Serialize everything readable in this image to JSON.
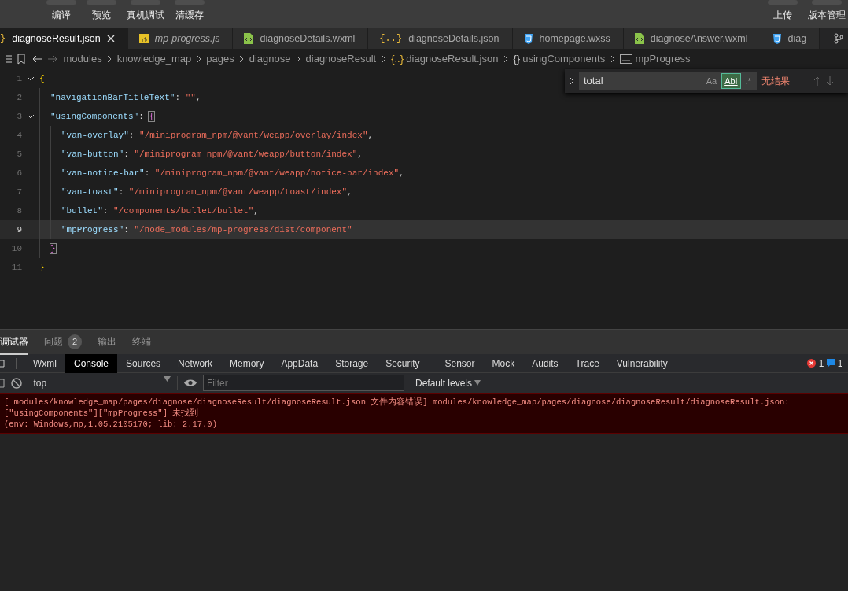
{
  "toolbar": {
    "left_buttons": [
      "编译",
      "预览",
      "真机调试",
      "清缓存"
    ],
    "right_buttons": [
      "上传",
      "版本管理"
    ]
  },
  "tabs": [
    {
      "label": "diagnoseResult.json",
      "kind": "json",
      "icon": "}",
      "selected": true,
      "preview": false,
      "closable": true
    },
    {
      "label": "mp-progress.js",
      "kind": "js",
      "selected": false,
      "preview": true,
      "closable": false
    },
    {
      "label": "diagnoseDetails.wxml",
      "kind": "wxml",
      "selected": false,
      "preview": false,
      "closable": false
    },
    {
      "label": "diagnoseDetails.json",
      "kind": "json",
      "icon": "{..}",
      "selected": false,
      "preview": false,
      "closable": false
    },
    {
      "label": "homepage.wxss",
      "kind": "wxss",
      "selected": false,
      "preview": false,
      "closable": false
    },
    {
      "label": "diagnoseAnswer.wxml",
      "kind": "wxml",
      "selected": false,
      "preview": false,
      "closable": false
    },
    {
      "label": "diag",
      "kind": "wxss",
      "selected": false,
      "preview": false,
      "closable": false
    }
  ],
  "breadcrumb": [
    {
      "label": "modules",
      "kind": "folder"
    },
    {
      "label": "knowledge_map",
      "kind": "folder"
    },
    {
      "label": "pages",
      "kind": "folder"
    },
    {
      "label": "diagnose",
      "kind": "folder"
    },
    {
      "label": "diagnoseResult",
      "kind": "folder"
    },
    {
      "label": "diagnoseResult.json",
      "kind": "json",
      "icon": "{..}"
    },
    {
      "label": "usingComponents",
      "kind": "object",
      "icon": "{}"
    },
    {
      "label": "mpProgress",
      "kind": "string"
    }
  ],
  "editor": {
    "lines": [
      {
        "number": "1",
        "foldable": true,
        "current": false,
        "tokens": [
          {
            "kind": "brace",
            "text": "{"
          }
        ],
        "children": [
          {
            "number": "2",
            "foldable": false,
            "current": false,
            "tokens": [
              {
                "kind": "key",
                "text": "\"navigationBarTitleText\""
              },
              {
                "kind": "punct",
                "text": ": "
              },
              {
                "kind": "string",
                "text": "\"\""
              },
              {
                "kind": "punct",
                "text": ","
              }
            ]
          },
          {
            "number": "3",
            "foldable": true,
            "current": false,
            "tokens": [
              {
                "kind": "key",
                "text": "\"usingComponents\""
              },
              {
                "kind": "punct",
                "text": ": "
              },
              {
                "kind": "matched",
                "text": "{"
              }
            ],
            "children": [
              {
                "number": "4",
                "foldable": false,
                "current": false,
                "tokens": [
                  {
                    "kind": "key",
                    "text": "\"van-overlay\""
                  },
                  {
                    "kind": "punct",
                    "text": ": "
                  },
                  {
                    "kind": "string",
                    "text": "\"/miniprogram_npm/@vant/weapp/overlay/index\""
                  },
                  {
                    "kind": "punct",
                    "text": ","
                  }
                ]
              },
              {
                "number": "5",
                "foldable": false,
                "current": false,
                "tokens": [
                  {
                    "kind": "key",
                    "text": "\"van-button\""
                  },
                  {
                    "kind": "punct",
                    "text": ": "
                  },
                  {
                    "kind": "string",
                    "text": "\"/miniprogram_npm/@vant/weapp/button/index\""
                  },
                  {
                    "kind": "punct",
                    "text": ","
                  }
                ]
              },
              {
                "number": "6",
                "foldable": false,
                "current": false,
                "tokens": [
                  {
                    "kind": "key",
                    "text": "\"van-notice-bar\""
                  },
                  {
                    "kind": "punct",
                    "text": ": "
                  },
                  {
                    "kind": "string",
                    "text": "\"/miniprogram_npm/@vant/weapp/notice-bar/index\""
                  },
                  {
                    "kind": "punct",
                    "text": ","
                  }
                ]
              },
              {
                "number": "7",
                "foldable": false,
                "current": false,
                "tokens": [
                  {
                    "kind": "key",
                    "text": "\"van-toast\""
                  },
                  {
                    "kind": "punct",
                    "text": ": "
                  },
                  {
                    "kind": "string",
                    "text": "\"/miniprogram_npm/@vant/weapp/toast/index\""
                  },
                  {
                    "kind": "punct",
                    "text": ","
                  }
                ]
              },
              {
                "number": "8",
                "foldable": false,
                "current": false,
                "tokens": [
                  {
                    "kind": "key",
                    "text": "\"bullet\""
                  },
                  {
                    "kind": "punct",
                    "text": ": "
                  },
                  {
                    "kind": "string",
                    "text": "\"/components/bullet/bullet\""
                  },
                  {
                    "kind": "punct",
                    "text": ","
                  }
                ]
              },
              {
                "number": "9",
                "foldable": false,
                "current": true,
                "tokens": [
                  {
                    "kind": "key",
                    "text": "\"mpProgress\""
                  },
                  {
                    "kind": "punct",
                    "text": ": "
                  },
                  {
                    "kind": "string",
                    "text": "\"/node_modules/mp-progress/dist/component\""
                  }
                ]
              }
            ]
          },
          {
            "number": "10",
            "foldable": false,
            "current": false,
            "tokens": [
              {
                "kind": "matched",
                "text": "}"
              }
            ]
          }
        ]
      },
      {
        "number": "11",
        "foldable": false,
        "current": false,
        "tokens": [
          {
            "kind": "brace",
            "text": "}"
          }
        ]
      }
    ]
  },
  "find_widget": {
    "value": "total",
    "options": [
      {
        "label": "Aa",
        "selected": false
      },
      {
        "label": "AbI",
        "selected": true
      },
      {
        "label": ".*",
        "selected": false
      }
    ],
    "result": "无结果"
  },
  "panel_tabs": [
    {
      "label": "调试器",
      "selected": true
    },
    {
      "label": "问题",
      "selected": false,
      "badge": "2"
    },
    {
      "label": "输出",
      "selected": false
    },
    {
      "label": "终端",
      "selected": false
    }
  ],
  "devtools_tabs": [
    {
      "label": "Wxml",
      "selected": false
    },
    {
      "label": "Console",
      "selected": true
    },
    {
      "label": "Sources",
      "selected": false
    },
    {
      "label": "Network",
      "selected": false
    },
    {
      "label": "Memory",
      "selected": false
    },
    {
      "label": "AppData",
      "selected": false
    },
    {
      "label": "Storage",
      "selected": false
    },
    {
      "label": "Security",
      "selected": false
    },
    {
      "label": "Sensor",
      "selected": false
    },
    {
      "label": "Mock",
      "selected": false
    },
    {
      "label": "Audits",
      "selected": false
    },
    {
      "label": "Trace",
      "selected": false
    },
    {
      "label": "Vulnerability",
      "selected": false
    }
  ],
  "counts": {
    "errors": "1",
    "messages": "1"
  },
  "console": {
    "context": "top",
    "filter_placeholder": "Filter",
    "levels": "Default levels",
    "messages": [
      {
        "kind": "error",
        "lines": [
          "[ modules/knowledge_map/pages/diagnose/diagnoseResult/diagnoseResult.json 文件内容错误] modules/knowledge_map/pages/diagnose/diagnoseResult/diagnoseResult.json:",
          "[\"usingComponents\"][\"mpProgress\"] 未找到",
          "(env: Windows,mp,1.05.2105170; lib: 2.17.0)"
        ]
      }
    ]
  }
}
